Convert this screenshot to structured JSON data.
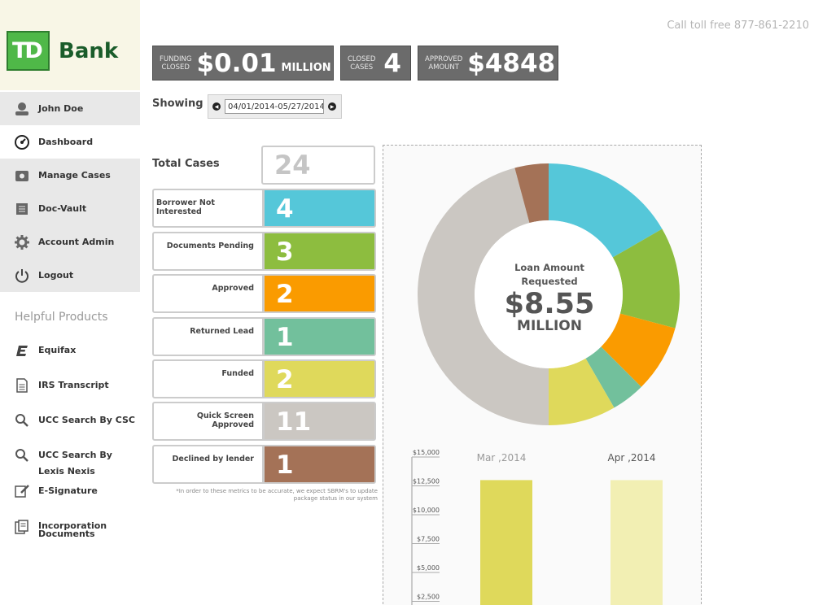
{
  "brand": {
    "logo_mark": "TD",
    "logo_word": "Bank",
    "accent": "#4fb848"
  },
  "header": {
    "toll_free": "Call toll free 877-861-2210"
  },
  "stats": [
    {
      "small": [
        "FUNDING",
        "CLOSED"
      ],
      "big": "$0.01",
      "unit": "MILLION"
    },
    {
      "small": [
        "CLOSED",
        "CASES"
      ],
      "big": "4",
      "unit": ""
    },
    {
      "small": [
        "APPROVED",
        "AMOUNT"
      ],
      "big": "$4848",
      "unit": ""
    }
  ],
  "showing": {
    "label": "Showing",
    "date_range": "04/01/2014-05/27/2014"
  },
  "sidebar": {
    "user": "John Doe",
    "items": [
      {
        "label": "Dashboard",
        "icon": "dashboard-icon"
      },
      {
        "label": "Manage Cases",
        "icon": "folder-icon"
      },
      {
        "label": "Doc-Vault",
        "icon": "document-icon"
      },
      {
        "label": "Account Admin",
        "icon": "gear-icon"
      },
      {
        "label": "Logout",
        "icon": "power-icon"
      }
    ],
    "helpful_title": "Helpful Products",
    "products": [
      {
        "label": "Equifax",
        "icon": "equifax-icon"
      },
      {
        "label": "IRS Transcript",
        "icon": "page-icon"
      },
      {
        "label": "UCC Search By CSC",
        "icon": "search-icon"
      },
      {
        "label": "UCC Search By Lexis Nexis",
        "icon": "search-icon"
      },
      {
        "label": "E-Signature",
        "icon": "pen-icon"
      },
      {
        "label": "Incorporation Documents",
        "icon": "documents-icon"
      }
    ]
  },
  "cases": {
    "total_label": "Total Cases",
    "total": "24",
    "rows": [
      {
        "label": "Borrower Not Interested",
        "value": "4",
        "color": "#55c7d9"
      },
      {
        "label": "Documents Pending",
        "value": "3",
        "color": "#8dbd3f"
      },
      {
        "label": "Approved",
        "value": "2",
        "color": "#fa9b00"
      },
      {
        "label": "Returned Lead",
        "value": "1",
        "color": "#72c09c"
      },
      {
        "label": "Funded",
        "value": "2",
        "color": "#dfd95b"
      },
      {
        "label": "Quick Screen Approved",
        "value": "11",
        "color": "#cbc7c2"
      },
      {
        "label": "Declined by lender",
        "value": "1",
        "color": "#a47257"
      }
    ],
    "footnote": "*In order to these metrics to be accurate, we expect SBRM's to update package status in our system"
  },
  "loan": {
    "label": "Loan Amount Requested",
    "amount": "$8.55",
    "unit": "MILLION"
  },
  "chart_data": [
    {
      "type": "pie",
      "title": "Loan Amount Requested",
      "categories": [
        "Borrower Not Interested",
        "Documents Pending",
        "Approved",
        "Returned Lead",
        "Funded",
        "Quick Screen Approved",
        "Declined by lender"
      ],
      "values": [
        4,
        3,
        2,
        1,
        2,
        11,
        1
      ],
      "colors": [
        "#55c7d9",
        "#8dbd3f",
        "#fa9b00",
        "#72c09c",
        "#dfd95b",
        "#cbc7c2",
        "#a47257"
      ]
    },
    {
      "type": "bar",
      "categories": [
        "Mar ,2014",
        "Apr ,2014"
      ],
      "values": [
        13000,
        13000
      ],
      "ylim": [
        2500,
        15000
      ],
      "yticks": [
        "$15,000",
        "$12,500",
        "$10,000",
        "$7,500",
        "$5,000",
        "$2,500"
      ],
      "ytick_values": [
        15000,
        12500,
        10000,
        7500,
        5000,
        2500
      ],
      "colors": [
        "#dfd95b",
        "#f2efb3"
      ],
      "label_colors": [
        "#999999",
        "#555555"
      ]
    }
  ]
}
